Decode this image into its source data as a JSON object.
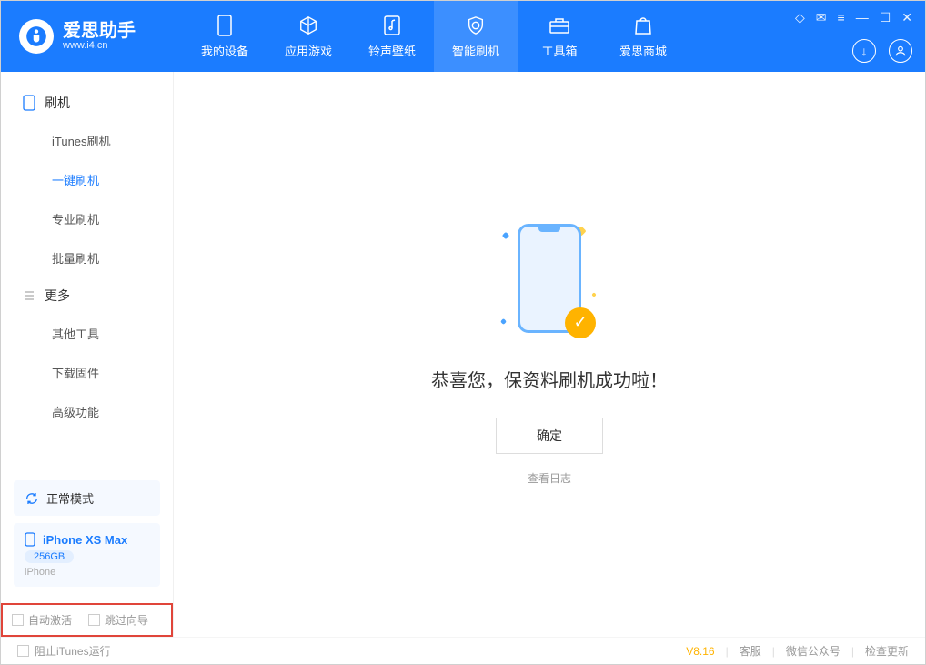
{
  "app": {
    "title": "爱思助手",
    "subtitle": "www.i4.cn"
  },
  "nav": [
    {
      "label": "我的设备"
    },
    {
      "label": "应用游戏"
    },
    {
      "label": "铃声壁纸"
    },
    {
      "label": "智能刷机"
    },
    {
      "label": "工具箱"
    },
    {
      "label": "爱思商城"
    }
  ],
  "sidebar": {
    "section1": {
      "title": "刷机",
      "items": [
        "iTunes刷机",
        "一键刷机",
        "专业刷机",
        "批量刷机"
      ]
    },
    "section2": {
      "title": "更多",
      "items": [
        "其他工具",
        "下载固件",
        "高级功能"
      ]
    }
  },
  "device": {
    "mode": "正常模式",
    "name": "iPhone XS Max",
    "capacity": "256GB",
    "type": "iPhone"
  },
  "checkboxes": {
    "auto_activate": "自动激活",
    "skip_guide": "跳过向导"
  },
  "main": {
    "success_text": "恭喜您，保资料刷机成功啦！",
    "ok_button": "确定",
    "log_link": "查看日志"
  },
  "footer": {
    "block_itunes": "阻止iTunes运行",
    "version": "V8.16",
    "links": [
      "客服",
      "微信公众号",
      "检查更新"
    ]
  }
}
